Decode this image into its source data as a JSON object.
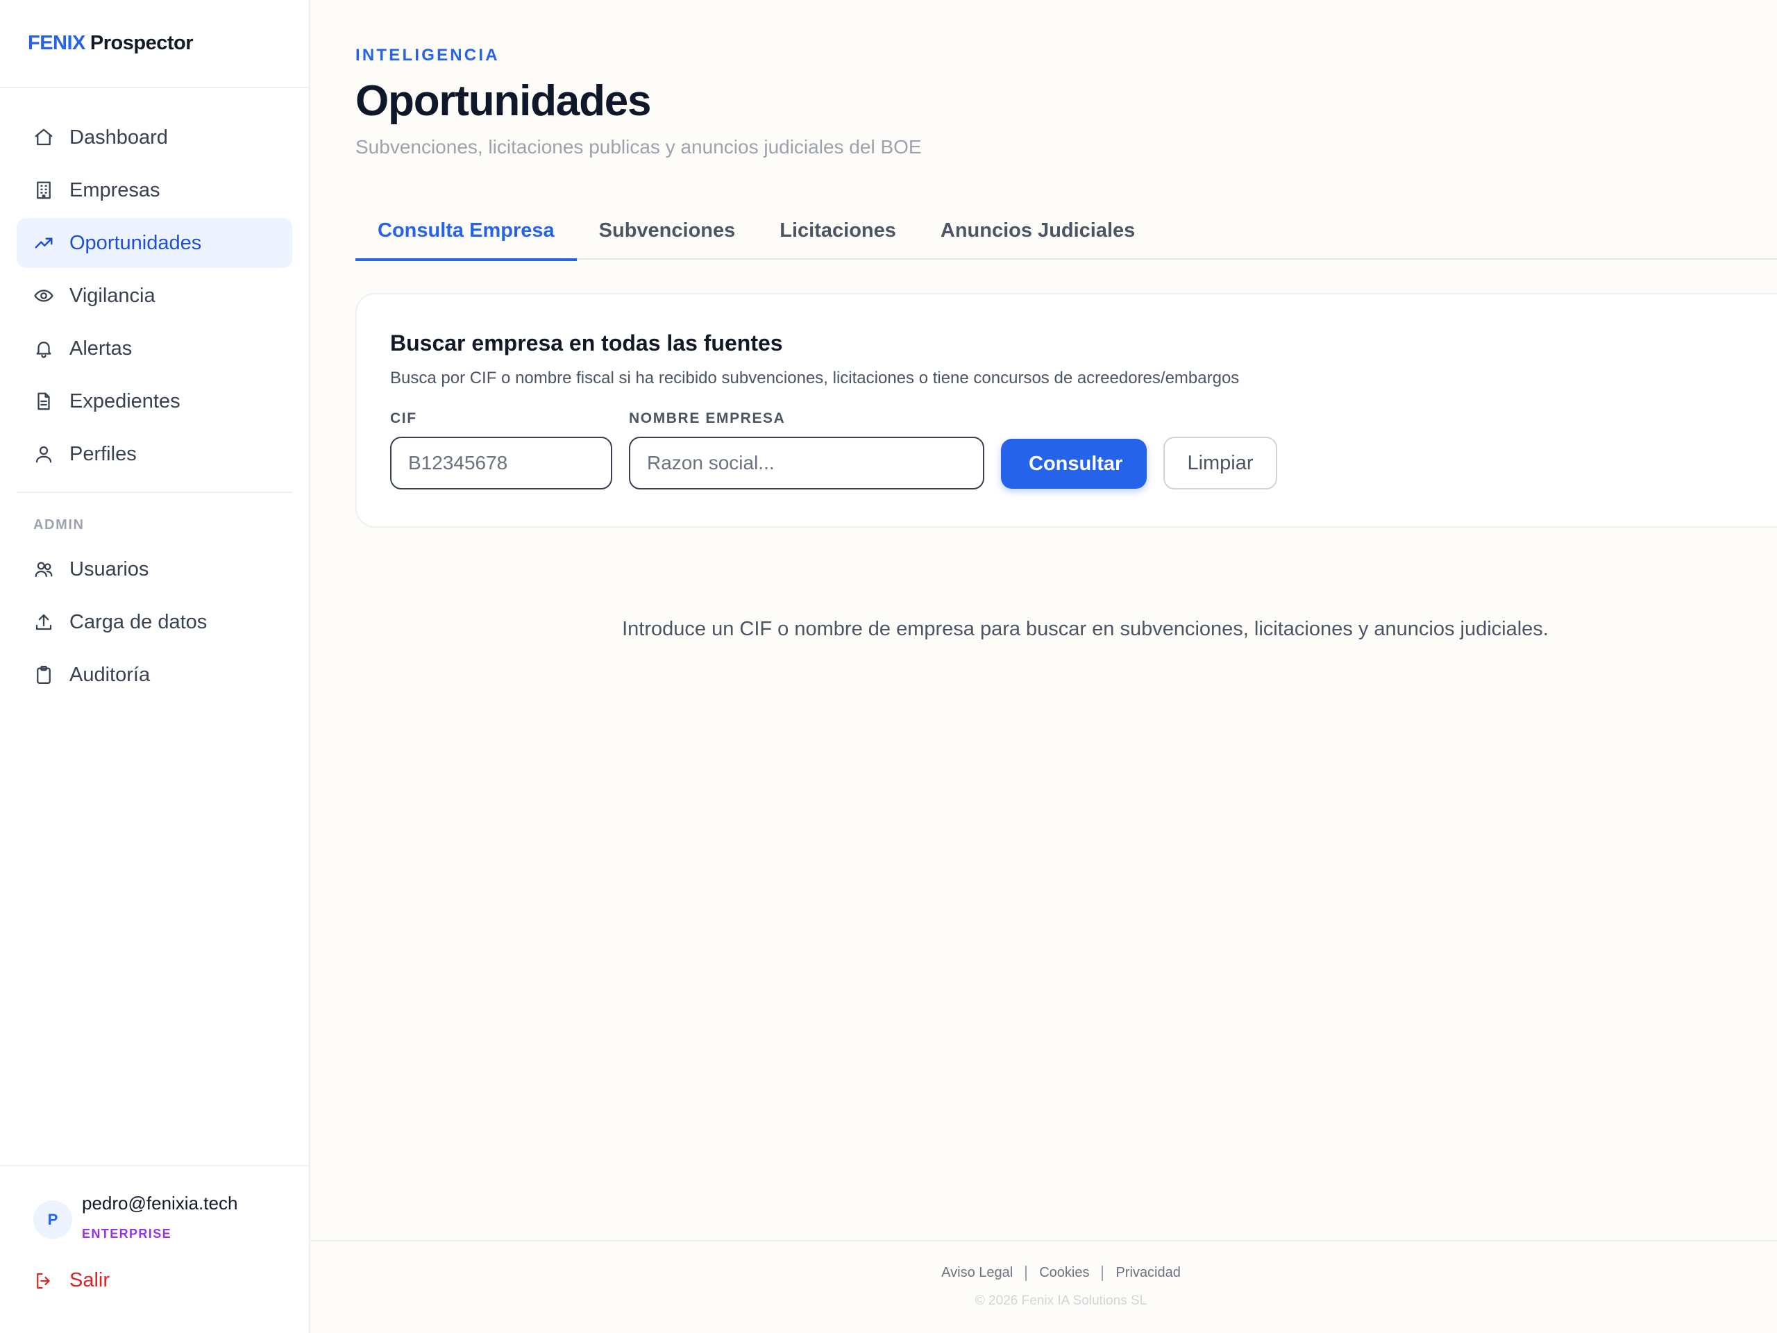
{
  "brand": {
    "part1": "FENIX",
    "part2": "Prospector"
  },
  "sidebar": {
    "nav": [
      {
        "label": "Dashboard",
        "icon": "home-icon"
      },
      {
        "label": "Empresas",
        "icon": "building-icon"
      },
      {
        "label": "Oportunidades",
        "icon": "trending-up-icon",
        "active": true
      },
      {
        "label": "Vigilancia",
        "icon": "eye-icon"
      },
      {
        "label": "Alertas",
        "icon": "bell-icon"
      },
      {
        "label": "Expedientes",
        "icon": "file-icon"
      },
      {
        "label": "Perfiles",
        "icon": "user-icon"
      }
    ],
    "admin_label": "ADMIN",
    "admin": [
      {
        "label": "Usuarios",
        "icon": "users-icon"
      },
      {
        "label": "Carga de datos",
        "icon": "upload-icon"
      },
      {
        "label": "Auditoría",
        "icon": "clipboard-icon"
      }
    ],
    "user": {
      "initial": "P",
      "email": "pedro@fenixia.tech",
      "plan": "ENTERPRISE"
    },
    "logout": "Salir"
  },
  "header": {
    "eyebrow": "INTELIGENCIA",
    "title": "Oportunidades",
    "subtitle": "Subvenciones, licitaciones publicas y anuncios judiciales del BOE"
  },
  "tabs": [
    {
      "label": "Consulta Empresa",
      "active": true
    },
    {
      "label": "Subvenciones"
    },
    {
      "label": "Licitaciones"
    },
    {
      "label": "Anuncios Judiciales"
    }
  ],
  "search_card": {
    "title": "Buscar empresa en todas las fuentes",
    "description": "Busca por CIF o nombre fiscal si ha recibido subvenciones, licitaciones o tiene concursos de acreedores/embargos",
    "cif_label": "CIF",
    "cif_placeholder": "B12345678",
    "name_label": "NOMBRE EMPRESA",
    "name_placeholder": "Razon social...",
    "submit": "Consultar",
    "clear": "Limpiar"
  },
  "empty_message": "Introduce un CIF o nombre de empresa para buscar en subvenciones, licitaciones y anuncios judiciales.",
  "footer": {
    "links": [
      "Aviso Legal",
      "Cookies",
      "Privacidad"
    ],
    "copyright": "© 2026 Fenix IA Solutions SL"
  },
  "colors": {
    "accent": "#2563eb",
    "active_bg": "#eef4ff",
    "plan": "#9333ea",
    "danger": "#dc2626",
    "background": "#fdfcf8"
  }
}
